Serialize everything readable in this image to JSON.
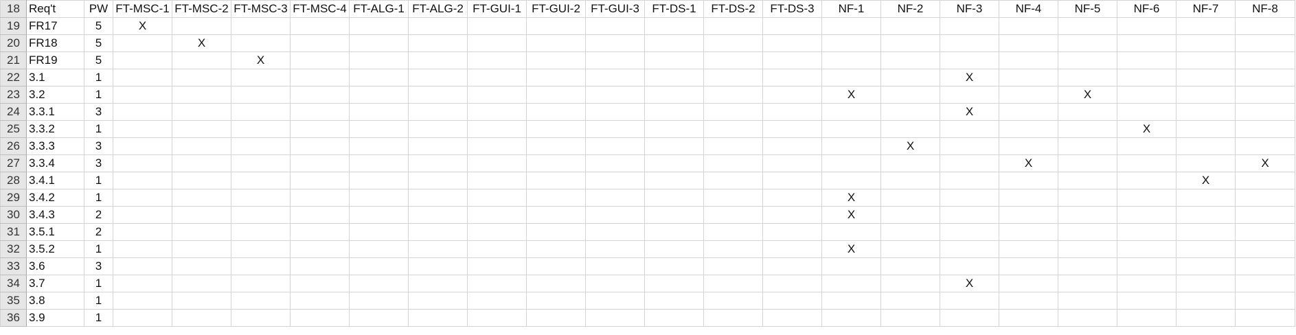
{
  "header": {
    "row_number": "18",
    "req_label": "Req't",
    "pw_label": "PW",
    "columns": [
      "FT-MSC-1",
      "FT-MSC-2",
      "FT-MSC-3",
      "FT-MSC-4",
      "FT-ALG-1",
      "FT-ALG-2",
      "FT-GUI-1",
      "FT-GUI-2",
      "FT-GUI-3",
      "FT-DS-1",
      "FT-DS-2",
      "FT-DS-3",
      "NF-1",
      "NF-2",
      "NF-3",
      "NF-4",
      "NF-5",
      "NF-6",
      "NF-7",
      "NF-8"
    ]
  },
  "rows": [
    {
      "num": "19",
      "req": "FR17",
      "pw": "5",
      "marks": [
        "X",
        "",
        "",
        "",
        "",
        "",
        "",
        "",
        "",
        "",
        "",
        "",
        "",
        "",
        "",
        "",
        "",
        "",
        "",
        ""
      ]
    },
    {
      "num": "20",
      "req": "FR18",
      "pw": "5",
      "marks": [
        "",
        "X",
        "",
        "",
        "",
        "",
        "",
        "",
        "",
        "",
        "",
        "",
        "",
        "",
        "",
        "",
        "",
        "",
        "",
        ""
      ]
    },
    {
      "num": "21",
      "req": "FR19",
      "pw": "5",
      "marks": [
        "",
        "",
        "X",
        "",
        "",
        "",
        "",
        "",
        "",
        "",
        "",
        "",
        "",
        "",
        "",
        "",
        "",
        "",
        "",
        ""
      ]
    },
    {
      "num": "22",
      "req": "3.1",
      "pw": "1",
      "marks": [
        "",
        "",
        "",
        "",
        "",
        "",
        "",
        "",
        "",
        "",
        "",
        "",
        "",
        "",
        "X",
        "",
        "",
        "",
        "",
        ""
      ]
    },
    {
      "num": "23",
      "req": "3.2",
      "pw": "1",
      "marks": [
        "",
        "",
        "",
        "",
        "",
        "",
        "",
        "",
        "",
        "",
        "",
        "",
        "X",
        "",
        "",
        "",
        "X",
        "",
        "",
        ""
      ]
    },
    {
      "num": "24",
      "req": "3.3.1",
      "pw": "3",
      "marks": [
        "",
        "",
        "",
        "",
        "",
        "",
        "",
        "",
        "",
        "",
        "",
        "",
        "",
        "",
        "X",
        "",
        "",
        "",
        "",
        ""
      ]
    },
    {
      "num": "25",
      "req": "3.3.2",
      "pw": "1",
      "marks": [
        "",
        "",
        "",
        "",
        "",
        "",
        "",
        "",
        "",
        "",
        "",
        "",
        "",
        "",
        "",
        "",
        "",
        "X",
        "",
        ""
      ]
    },
    {
      "num": "26",
      "req": "3.3.3",
      "pw": "3",
      "marks": [
        "",
        "",
        "",
        "",
        "",
        "",
        "",
        "",
        "",
        "",
        "",
        "",
        "",
        "X",
        "",
        "",
        "",
        "",
        "",
        ""
      ]
    },
    {
      "num": "27",
      "req": "3.3.4",
      "pw": "3",
      "marks": [
        "",
        "",
        "",
        "",
        "",
        "",
        "",
        "",
        "",
        "",
        "",
        "",
        "",
        "",
        "",
        "X",
        "",
        "",
        "",
        "X"
      ]
    },
    {
      "num": "28",
      "req": "3.4.1",
      "pw": "1",
      "marks": [
        "",
        "",
        "",
        "",
        "",
        "",
        "",
        "",
        "",
        "",
        "",
        "",
        "",
        "",
        "",
        "",
        "",
        "",
        "X",
        ""
      ]
    },
    {
      "num": "29",
      "req": "3.4.2",
      "pw": "1",
      "marks": [
        "",
        "",
        "",
        "",
        "",
        "",
        "",
        "",
        "",
        "",
        "",
        "",
        "X",
        "",
        "",
        "",
        "",
        "",
        "",
        ""
      ]
    },
    {
      "num": "30",
      "req": "3.4.3",
      "pw": "2",
      "marks": [
        "",
        "",
        "",
        "",
        "",
        "",
        "",
        "",
        "",
        "",
        "",
        "",
        "X",
        "",
        "",
        "",
        "",
        "",
        "",
        ""
      ]
    },
    {
      "num": "31",
      "req": "3.5.1",
      "pw": "2",
      "marks": [
        "",
        "",
        "",
        "",
        "",
        "",
        "",
        "",
        "",
        "",
        "",
        "",
        "",
        "",
        "",
        "",
        "",
        "",
        "",
        ""
      ]
    },
    {
      "num": "32",
      "req": "3.5.2",
      "pw": "1",
      "marks": [
        "",
        "",
        "",
        "",
        "",
        "",
        "",
        "",
        "",
        "",
        "",
        "",
        "X",
        "",
        "",
        "",
        "",
        "",
        "",
        ""
      ]
    },
    {
      "num": "33",
      "req": "3.6",
      "pw": "3",
      "marks": [
        "",
        "",
        "",
        "",
        "",
        "",
        "",
        "",
        "",
        "",
        "",
        "",
        "",
        "",
        "",
        "",
        "",
        "",
        "",
        ""
      ]
    },
    {
      "num": "34",
      "req": "3.7",
      "pw": "1",
      "marks": [
        "",
        "",
        "",
        "",
        "",
        "",
        "",
        "",
        "",
        "",
        "",
        "",
        "",
        "",
        "X",
        "",
        "",
        "",
        "",
        ""
      ]
    },
    {
      "num": "35",
      "req": "3.8",
      "pw": "1",
      "marks": [
        "",
        "",
        "",
        "",
        "",
        "",
        "",
        "",
        "",
        "",
        "",
        "",
        "",
        "",
        "",
        "",
        "",
        "",
        "",
        ""
      ]
    },
    {
      "num": "36",
      "req": "3.9",
      "pw": "1",
      "marks": [
        "",
        "",
        "",
        "",
        "",
        "",
        "",
        "",
        "",
        "",
        "",
        "",
        "",
        "",
        "",
        "",
        "",
        "",
        "",
        ""
      ]
    }
  ]
}
